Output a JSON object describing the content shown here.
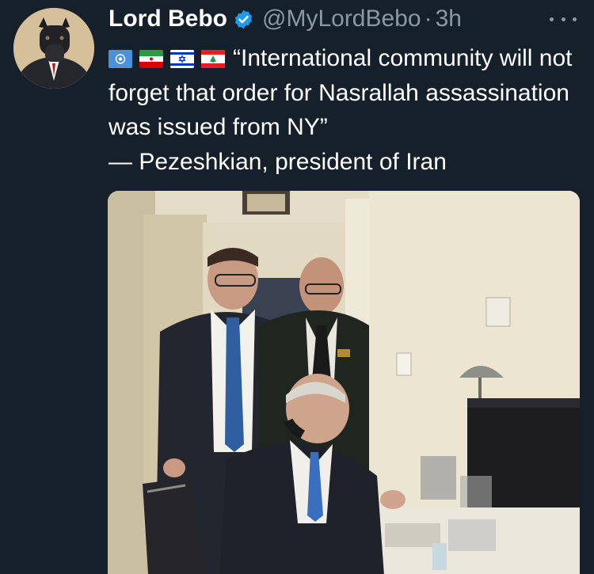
{
  "author": {
    "name": "Lord Bebo",
    "handle": "@MyLordBebo",
    "separator": "·",
    "time": "3h",
    "verified": true
  },
  "tweet": {
    "flags": [
      "united-nations-flag",
      "iran-flag",
      "israel-flag",
      "lebanon-flag"
    ],
    "quote": "“International community will not forget that order for Nasrallah assassination was issued from NY”",
    "attribution": "— Pezeshkian, president of Iran"
  },
  "colors": {
    "background": "#15202b",
    "secondary_text": "#8b98a5",
    "verified_blue": "#1d9bf0"
  }
}
